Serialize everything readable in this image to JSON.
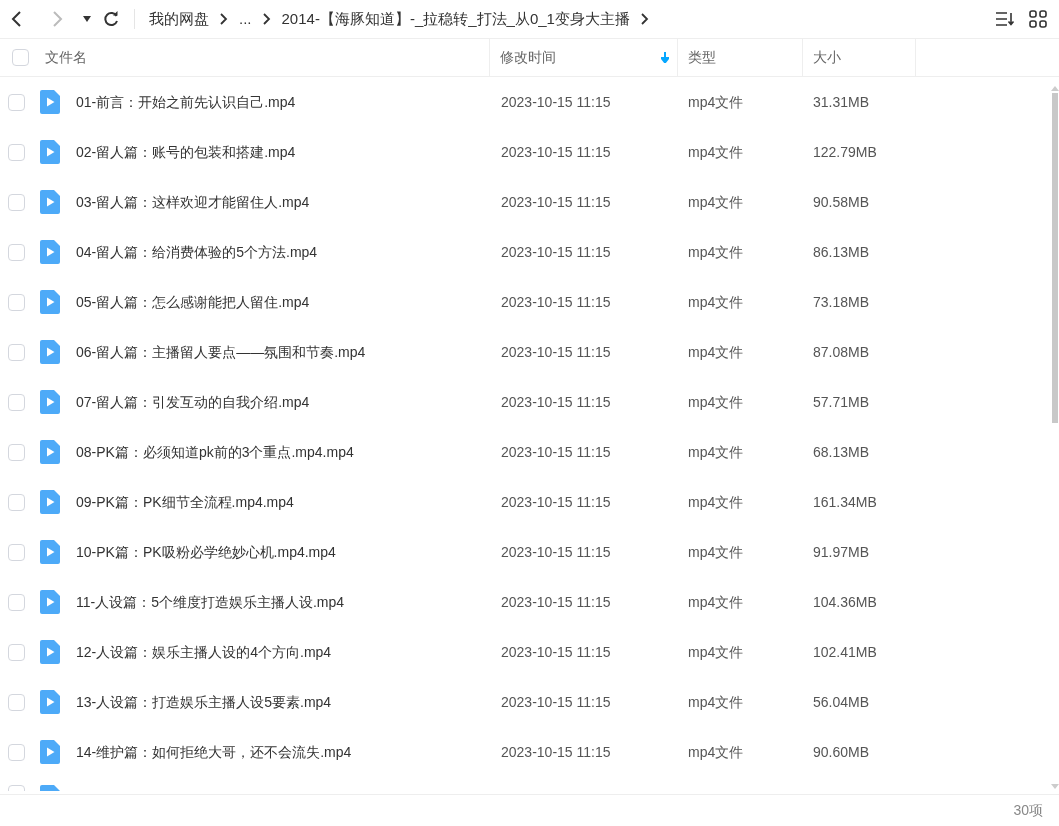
{
  "breadcrumb": [
    {
      "label": "我的网盘"
    },
    {
      "label": "..."
    },
    {
      "label": "2014-【海豚知道】-_拉稳转_打法_从0_1变身大主播"
    }
  ],
  "header": {
    "checked": false,
    "columns": [
      {
        "label": "文件名",
        "sorted": false
      },
      {
        "label": "修改时间",
        "sorted": true
      },
      {
        "label": "类型",
        "sorted": false
      },
      {
        "label": "大小",
        "sorted": false
      }
    ]
  },
  "rows": [
    {
      "name": "01-前言：开始之前先认识自己.mp4",
      "modified": "2023-10-15 11:15",
      "type": "mp4文件",
      "size": "31.31MB",
      "checked": false
    },
    {
      "name": "02-留人篇：账号的包装和搭建.mp4",
      "modified": "2023-10-15 11:15",
      "type": "mp4文件",
      "size": "122.79MB",
      "checked": false
    },
    {
      "name": "03-留人篇：这样欢迎才能留住人.mp4",
      "modified": "2023-10-15 11:15",
      "type": "mp4文件",
      "size": "90.58MB",
      "checked": false
    },
    {
      "name": "04-留人篇：给消费体验的5个方法.mp4",
      "modified": "2023-10-15 11:15",
      "type": "mp4文件",
      "size": "86.13MB",
      "checked": false
    },
    {
      "name": "05-留人篇：怎么感谢能把人留住.mp4",
      "modified": "2023-10-15 11:15",
      "type": "mp4文件",
      "size": "73.18MB",
      "checked": false
    },
    {
      "name": "06-留人篇：主播留人要点——氛围和节奏.mp4",
      "modified": "2023-10-15 11:15",
      "type": "mp4文件",
      "size": "87.08MB",
      "checked": false
    },
    {
      "name": "07-留人篇：引发互动的自我介绍.mp4",
      "modified": "2023-10-15 11:15",
      "type": "mp4文件",
      "size": "57.71MB",
      "checked": false
    },
    {
      "name": "08-PK篇：必须知道pk前的3个重点.mp4.mp4",
      "modified": "2023-10-15 11:15",
      "type": "mp4文件",
      "size": "68.13MB",
      "checked": false
    },
    {
      "name": "09-PK篇：PK细节全流程.mp4.mp4",
      "modified": "2023-10-15 11:15",
      "type": "mp4文件",
      "size": "161.34MB",
      "checked": false
    },
    {
      "name": "10-PK篇：PK吸粉必学绝妙心机.mp4.mp4",
      "modified": "2023-10-15 11:15",
      "type": "mp4文件",
      "size": "91.97MB",
      "checked": false
    },
    {
      "name": "11-人设篇：5个维度打造娱乐主播人设.mp4",
      "modified": "2023-10-15 11:15",
      "type": "mp4文件",
      "size": "104.36MB",
      "checked": false
    },
    {
      "name": "12-人设篇：娱乐主播人设的4个方向.mp4",
      "modified": "2023-10-15 11:15",
      "type": "mp4文件",
      "size": "102.41MB",
      "checked": false
    },
    {
      "name": "13-人设篇：打造娱乐主播人设5要素.mp4",
      "modified": "2023-10-15 11:15",
      "type": "mp4文件",
      "size": "56.04MB",
      "checked": false
    },
    {
      "name": "14-维护篇：如何拒绝大哥，还不会流失.mp4",
      "modified": "2023-10-15 11:15",
      "type": "mp4文件",
      "size": "90.60MB",
      "checked": false
    }
  ],
  "partial_row": {
    "checked": false
  },
  "status_bar": {
    "count": "30项"
  }
}
